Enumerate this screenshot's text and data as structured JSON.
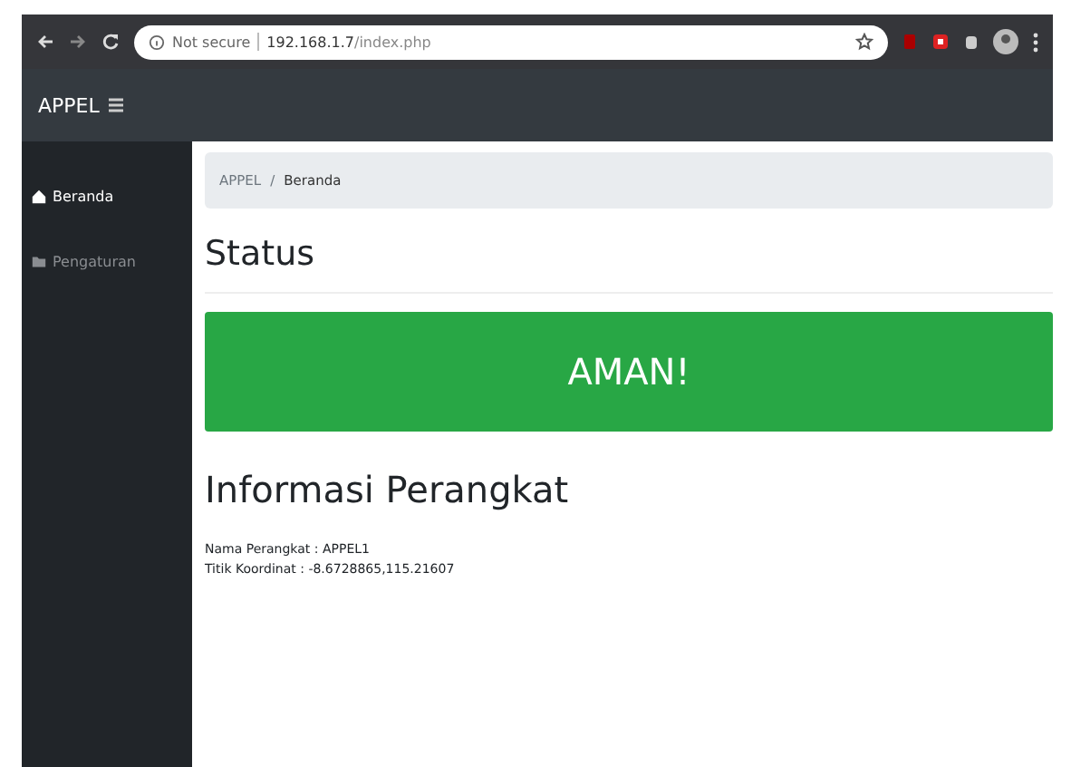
{
  "browser": {
    "security": "Not secure",
    "url": "192.168.1.7",
    "url_path": "/index.php"
  },
  "navbar": {
    "brand": "APPEL"
  },
  "sidebar": {
    "items": [
      {
        "label": "Beranda",
        "kind": "home",
        "selected": true
      },
      {
        "label": "Pengaturan",
        "kind": "folder",
        "selected": false
      }
    ]
  },
  "breadcrumb": {
    "items": [
      "APPEL",
      "Beranda"
    ],
    "separator": "/"
  },
  "status": {
    "heading": "Status",
    "message": "AMAN!",
    "kind": "safe"
  },
  "device": {
    "heading": "Informasi Perangkat",
    "fields": [
      "Nama Perangkat : APPEL1",
      "Titik Koordinat : -8.6728865,115.21607"
    ]
  }
}
